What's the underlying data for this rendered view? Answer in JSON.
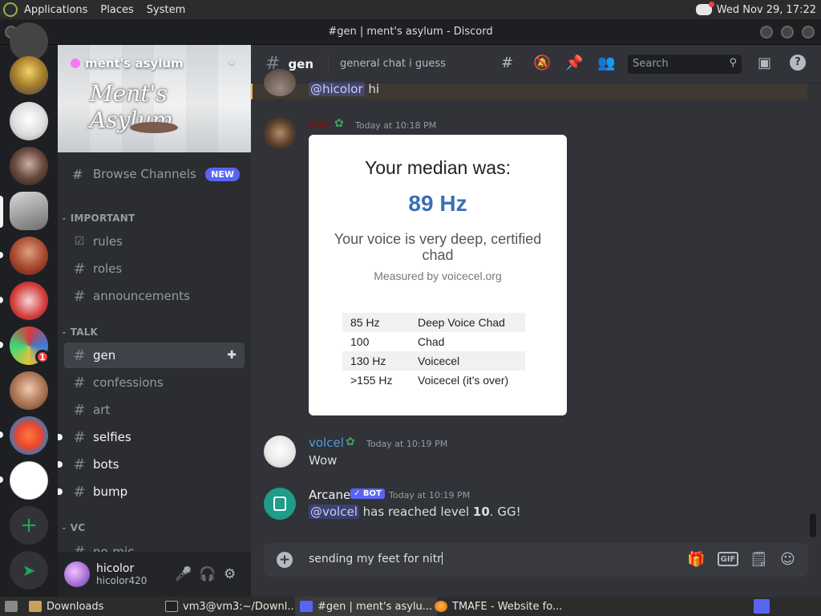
{
  "top_panel": {
    "menus": [
      "Applications",
      "Places",
      "System"
    ],
    "clock": "Wed Nov 29, 17:22"
  },
  "window": {
    "title": "#gen | ment's asylum - Discord"
  },
  "rail": {
    "unread_badge": "1"
  },
  "server": {
    "name": "ment's asylum",
    "banner_text": "Ment's Asylum",
    "browse_label": "Browse Channels",
    "new_badge": "NEW"
  },
  "categories": {
    "important": "IMPORTANT",
    "talk": "TALK",
    "vc": "VC"
  },
  "channels": {
    "rules": "rules",
    "roles": "roles",
    "announcements": "announcements",
    "gen": "gen",
    "confessions": "confessions",
    "art": "art",
    "selfies": "selfies",
    "bots": "bots",
    "bump": "bump",
    "no_mic": "no-mic"
  },
  "user_panel": {
    "username": "hicolor",
    "tag": "hicolor420"
  },
  "header": {
    "channel": "gen",
    "topic": "general chat i guess",
    "search_placeholder": "Search"
  },
  "messages": {
    "top_mention": "@hicolor",
    "top_text": "hi",
    "kari": {
      "name": "kari",
      "time": "Today at 10:18 PM",
      "name_color": "#8b0e0e"
    },
    "volcel": {
      "name": "volcel",
      "time": "Today at 10:19 PM",
      "text": "Wow",
      "name_color": "#4a9fe0"
    },
    "arcane": {
      "name": "Arcane",
      "bot_tag": "✓ BOT",
      "time": "Today at 10:19 PM",
      "mention": "@volcel",
      "text_before": "has reached level",
      "level": "10",
      "text_after": ". GG!"
    }
  },
  "embed": {
    "title": "Your median was:",
    "hz": "89 Hz",
    "description": "Your voice is very deep, certified chad",
    "measured": "Measured by voicecel.org",
    "table": [
      [
        "85 Hz",
        "Deep Voice Chad"
      ],
      [
        "100",
        "Chad"
      ],
      [
        "130 Hz",
        "Voicecel"
      ],
      [
        ">155 Hz",
        "Voicecel (it's over)"
      ]
    ]
  },
  "composer": {
    "value": "sending my feet for nitr",
    "gif_label": "GIF"
  },
  "taskbar": {
    "items": [
      "Downloads",
      "vm3@vm3:~/Downl...",
      "#gen | ment's asylu...",
      "TMAFE - Website fo..."
    ]
  },
  "colors": {
    "accent": "#5865f2",
    "green": "#23a559",
    "mention_bar": "#f0b232"
  }
}
